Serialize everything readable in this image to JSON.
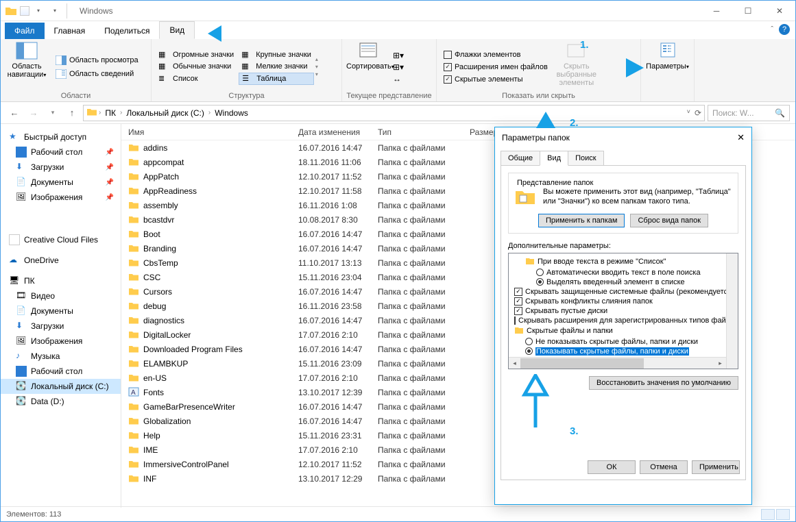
{
  "window": {
    "title": "Windows"
  },
  "tabs": {
    "file": "Файл",
    "home": "Главная",
    "share": "Поделиться",
    "view": "Вид"
  },
  "ribbon": {
    "panes": {
      "nav_pane": "Область навигации",
      "preview_pane": "Область просмотра",
      "details_pane": "Область сведений",
      "group_panes": "Области"
    },
    "layout": {
      "extra_large": "Огромные значки",
      "large": "Крупные значки",
      "medium": "Обычные значки",
      "small": "Мелкие значки",
      "list": "Список",
      "details": "Таблица",
      "group": "Структура"
    },
    "current_view": {
      "sort": "Сортировать",
      "group": "Текущее представление"
    },
    "show_hide": {
      "item_checkboxes": "Флажки элементов",
      "file_ext": "Расширения имен файлов",
      "hidden_items": "Скрытые элементы",
      "hide_selected": "Скрыть выбранные элементы",
      "options": "Параметры",
      "group": "Показать или скрыть"
    }
  },
  "breadcrumb": [
    "ПК",
    "Локальный диск (C:)",
    "Windows"
  ],
  "search": {
    "placeholder": "Поиск: W..."
  },
  "sidebar": {
    "quick_access": "Быстрый доступ",
    "desktop": "Рабочий стол",
    "downloads": "Загрузки",
    "documents": "Документы",
    "pictures": "Изображения",
    "creative_cloud": "Creative Cloud Files",
    "onedrive": "OneDrive",
    "this_pc": "ПК",
    "videos": "Видео",
    "documents2": "Документы",
    "downloads2": "Загрузки",
    "pictures2": "Изображения",
    "music": "Музыка",
    "desktop2": "Рабочий стол",
    "local_disk": "Локальный диск (C:)",
    "data_d": "Data (D:)"
  },
  "columns": {
    "name": "Имя",
    "date": "Дата изменения",
    "type": "Тип",
    "size": "Размер"
  },
  "default_type": "Папка с файлами",
  "files": [
    {
      "name": "addins",
      "date": "16.07.2016 14:47"
    },
    {
      "name": "appcompat",
      "date": "18.11.2016 11:06"
    },
    {
      "name": "AppPatch",
      "date": "12.10.2017 11:52"
    },
    {
      "name": "AppReadiness",
      "date": "12.10.2017 11:58"
    },
    {
      "name": "assembly",
      "date": "16.11.2016 1:08"
    },
    {
      "name": "bcastdvr",
      "date": "10.08.2017 8:30"
    },
    {
      "name": "Boot",
      "date": "16.07.2016 14:47"
    },
    {
      "name": "Branding",
      "date": "16.07.2016 14:47"
    },
    {
      "name": "CbsTemp",
      "date": "11.10.2017 13:13"
    },
    {
      "name": "CSC",
      "date": "15.11.2016 23:04"
    },
    {
      "name": "Cursors",
      "date": "16.07.2016 14:47"
    },
    {
      "name": "debug",
      "date": "16.11.2016 23:58"
    },
    {
      "name": "diagnostics",
      "date": "16.07.2016 14:47"
    },
    {
      "name": "DigitalLocker",
      "date": "17.07.2016 2:10"
    },
    {
      "name": "Downloaded Program Files",
      "date": "16.07.2016 14:47"
    },
    {
      "name": "ELAMBKUP",
      "date": "15.11.2016 23:09"
    },
    {
      "name": "en-US",
      "date": "17.07.2016 2:10"
    },
    {
      "name": "Fonts",
      "date": "13.10.2017 12:39"
    },
    {
      "name": "GameBarPresenceWriter",
      "date": "16.07.2016 14:47"
    },
    {
      "name": "Globalization",
      "date": "16.07.2016 14:47"
    },
    {
      "name": "Help",
      "date": "15.11.2016 23:31"
    },
    {
      "name": "IME",
      "date": "17.07.2016 2:10"
    },
    {
      "name": "ImmersiveControlPanel",
      "date": "12.10.2017 11:52"
    },
    {
      "name": "INF",
      "date": "13.10.2017 12:29"
    }
  ],
  "statusbar": {
    "count": "Элементов: 113"
  },
  "dialog": {
    "title": "Параметры папок",
    "tabs": {
      "general": "Общие",
      "view": "Вид",
      "search": "Поиск"
    },
    "folder_views": {
      "legend": "Представление папок",
      "desc": "Вы можете применить этот вид (например, \"Таблица\" или \"Значки\") ко всем папкам такого типа.",
      "apply": "Применить к папкам",
      "reset": "Сброс вида папок"
    },
    "advanced": {
      "legend": "Дополнительные параметры:",
      "type_list_mode": "При вводе текста в режиме \"Список\"",
      "auto_type": "Автоматически вводить текст в поле поиска",
      "select_typed": "Выделять введенный элемент в списке",
      "hide_protected": "Скрывать защищенные системные файлы (рекомендуется)",
      "hide_merge": "Скрывать конфликты слияния папок",
      "hide_empty": "Скрывать пустые диски",
      "hide_ext": "Скрывать расширения для зарегистрированных типов файлов",
      "hidden_group": "Скрытые файлы и папки",
      "dont_show": "Не показывать скрытые файлы, папки и диски",
      "show_hidden": "Показывать скрытые файлы, папки и диски"
    },
    "restore": "Восстановить значения по умолчанию",
    "ok": "ОК",
    "cancel": "Отмена",
    "apply": "Применить"
  },
  "annotations": {
    "n1": "1.",
    "n2": "2.",
    "n3": "3."
  }
}
